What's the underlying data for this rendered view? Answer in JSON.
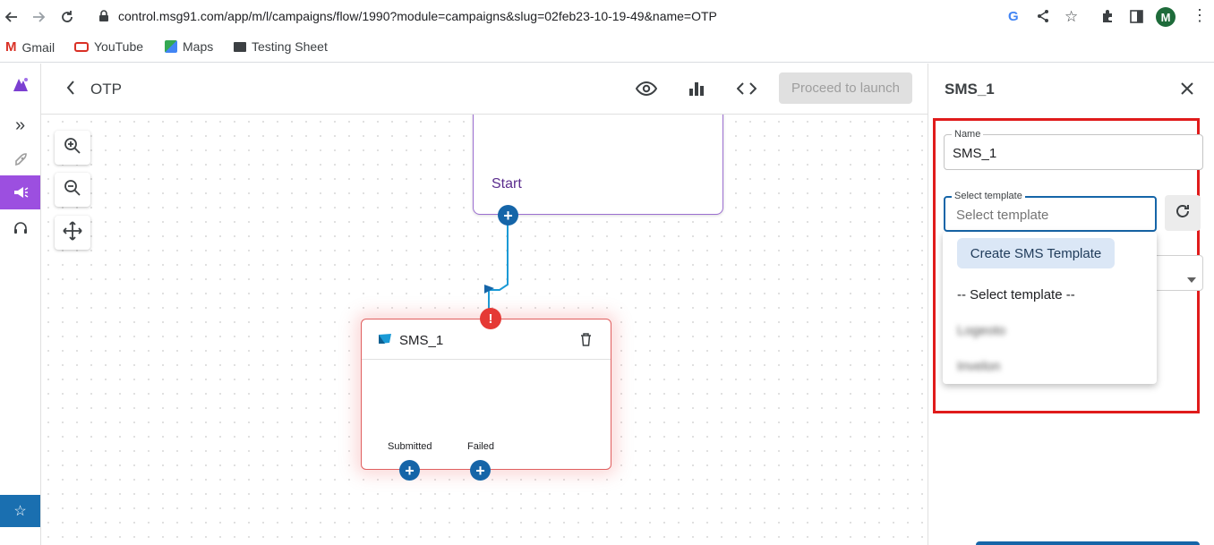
{
  "browser": {
    "url": "control.msg91.com/app/m/l/campaigns/flow/1990?module=campaigns&slug=02feb23-10-19-49&name=OTP",
    "avatar_letter": "M",
    "bookmarks": [
      {
        "label": "Gmail",
        "icon": "gmail-icon"
      },
      {
        "label": "YouTube",
        "icon": "youtube-icon"
      },
      {
        "label": "Maps",
        "icon": "maps-icon"
      },
      {
        "label": "Testing Sheet",
        "icon": "folder-icon"
      }
    ]
  },
  "header": {
    "title": "OTP",
    "proceed_label": "Proceed to launch"
  },
  "canvas": {
    "start_node_label": "Start",
    "sms_node": {
      "title": "SMS_1",
      "outputs": [
        "Submitted",
        "Failed"
      ],
      "error_mark": "!"
    }
  },
  "panel": {
    "title": "SMS_1",
    "name_label": "Name",
    "name_value": "SMS_1",
    "template_label": "Select template",
    "template_placeholder": "Select template",
    "dropdown": {
      "create_label": "Create SMS Template",
      "default_option": "-- Select template --",
      "blurred_options": [
        "Logeoto",
        "Invelon"
      ]
    }
  },
  "colors": {
    "accent_purple": "#8b4fd6",
    "node_blue": "#1565a8",
    "error_red": "#e53935",
    "highlight_red": "#e01b1b"
  }
}
